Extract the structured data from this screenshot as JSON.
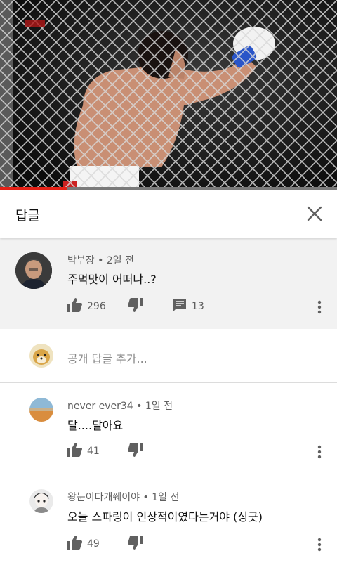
{
  "panel": {
    "title": "답글",
    "close_icon": "close-icon"
  },
  "video": {
    "progress_fraction": 0.2,
    "accent": "#e62117"
  },
  "main_comment": {
    "author": "박부장",
    "time": "2일 전",
    "text": "주먹맛이 어떠냐..?",
    "likes": "296",
    "replies": "13"
  },
  "add_reply": {
    "placeholder": "공개 답글 추가..."
  },
  "replies": [
    {
      "author": "never ever34",
      "time": "1일 전",
      "text": "달....달아요",
      "likes": "41"
    },
    {
      "author": "왕눈이다개쒜이야",
      "time": "1일 전",
      "text": "오늘 스파링이 인상적이였다는거야 (싱긋)",
      "likes": "49"
    }
  ]
}
